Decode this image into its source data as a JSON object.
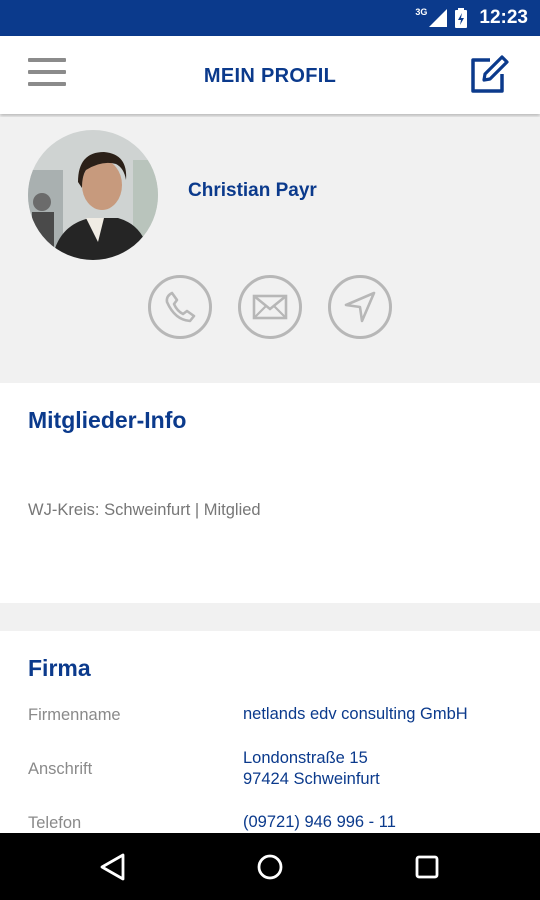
{
  "status_bar": {
    "network": "3G",
    "time": "12:23"
  },
  "app_bar": {
    "title": "MEIN PROFIL"
  },
  "profile": {
    "name": "Christian Payr"
  },
  "member_info": {
    "heading": "Mitglieder-Info",
    "kreis_text": "WJ-Kreis: Schweinfurt | Mitglied"
  },
  "company": {
    "heading": "Firma",
    "rows": [
      {
        "label": "Firmenname",
        "value_line1": "netlands edv consulting GmbH",
        "value_line2": ""
      },
      {
        "label": "Anschrift",
        "value_line1": "Londonstraße 15",
        "value_line2": "97424 Schweinfurt"
      },
      {
        "label": "Telefon",
        "value_line1": "(09721) 946 996 - 11",
        "value_line2": ""
      }
    ]
  },
  "colors": {
    "primary": "#0b3a8c",
    "statusbar": "#0b3a8c",
    "muted": "#8a8a8a",
    "icon_gray": "#b7b7b7"
  }
}
